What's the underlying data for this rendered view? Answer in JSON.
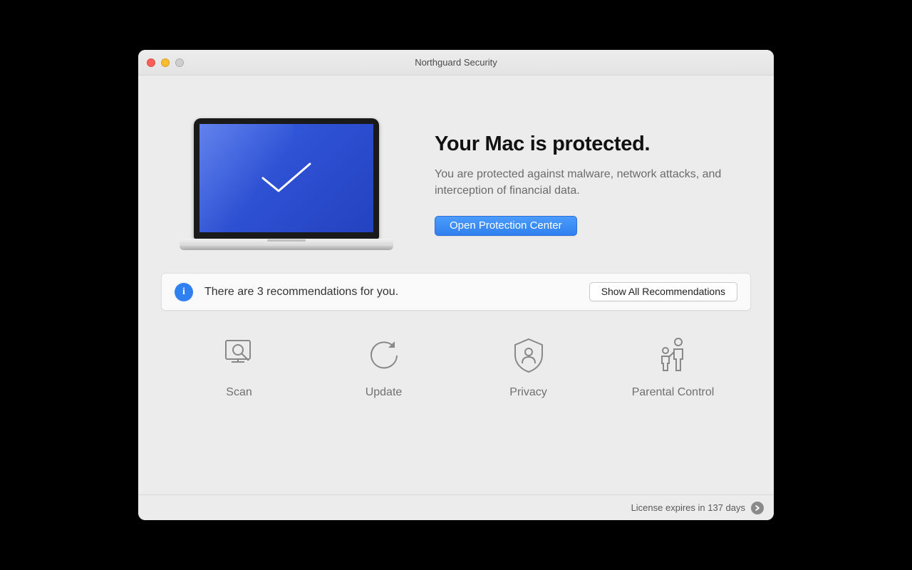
{
  "window": {
    "title": "Northguard Security"
  },
  "hero": {
    "title": "Your Mac is protected.",
    "subtitle": "You are protected against malware, network attacks, and interception of financial data.",
    "primary_button": "Open Protection Center"
  },
  "recommendations": {
    "count": 3,
    "text": "There are 3 recommendations for you.",
    "button": "Show All Recommendations"
  },
  "features": {
    "scan": "Scan",
    "update": "Update",
    "privacy": "Privacy",
    "parental": "Parental Control"
  },
  "footer": {
    "license_text": "License expires in 137 days",
    "license_days_remaining": 137
  },
  "colors": {
    "primary_blue": "#2f80f0",
    "screen_blue": "#2d4fd1"
  }
}
